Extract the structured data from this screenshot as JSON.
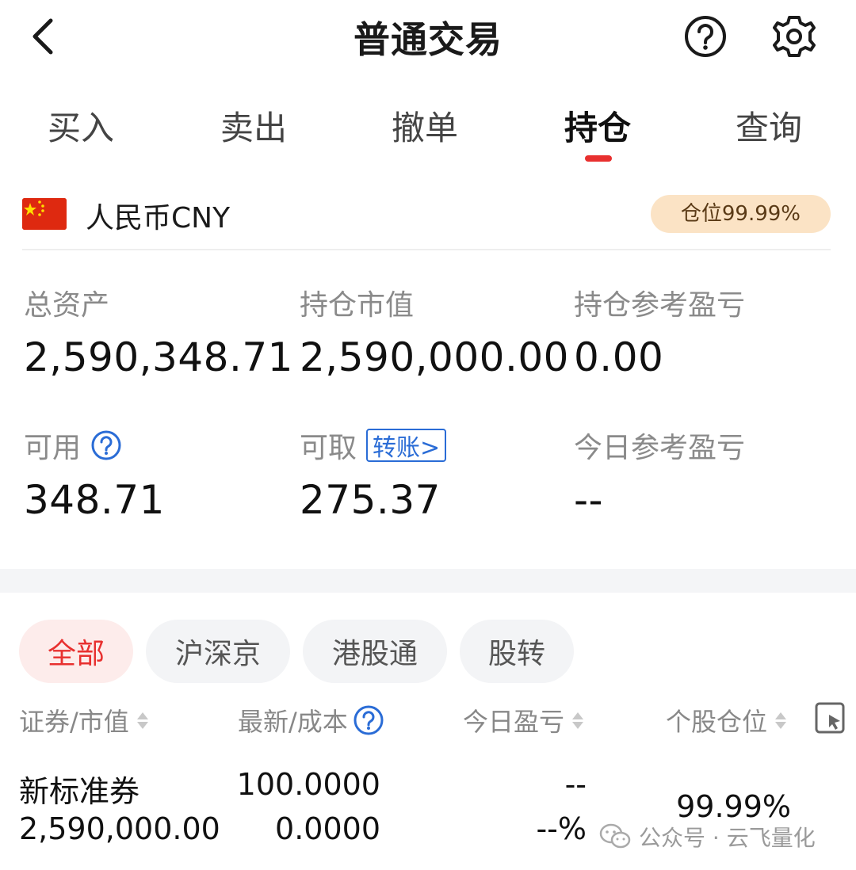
{
  "header": {
    "title": "普通交易"
  },
  "tabs": [
    {
      "label": "买入"
    },
    {
      "label": "卖出"
    },
    {
      "label": "撤单"
    },
    {
      "label": "持仓",
      "active": true
    },
    {
      "label": "查询"
    }
  ],
  "account": {
    "currency": "人民币CNY",
    "position_badge": "仓位99.99%"
  },
  "stats": {
    "total_assets_label": "总资产",
    "total_assets_value": "2,590,348.71",
    "market_value_label": "持仓市值",
    "market_value_value": "2,590,000.00",
    "holding_pnl_label": "持仓参考盈亏",
    "holding_pnl_value": "0.00",
    "available_label": "可用",
    "available_value": "348.71",
    "withdrawable_label": "可取",
    "transfer_link": "转账>",
    "withdrawable_value": "275.37",
    "today_pnl_label": "今日参考盈亏",
    "today_pnl_value": "--"
  },
  "filters": [
    {
      "label": "全部",
      "active": true
    },
    {
      "label": "沪深京"
    },
    {
      "label": "港股通"
    },
    {
      "label": "股转"
    }
  ],
  "table": {
    "headers": {
      "security": "证券/市值",
      "price_cost": "最新/成本",
      "today_pnl": "今日盈亏",
      "position_ratio": "个股仓位"
    },
    "rows": [
      {
        "name": "新标准券",
        "market_value": "2,590,000.00",
        "latest_price": "100.0000",
        "cost": "0.0000",
        "today_pnl": "--",
        "today_pnl_pct": "--%",
        "position_ratio": "99.99%"
      }
    ]
  },
  "watermark": {
    "text": "公众号 · 云飞量化"
  },
  "colors": {
    "accent_red": "#e8302f",
    "link_blue": "#2a6cd6",
    "badge_bg": "#fbe3c5"
  }
}
